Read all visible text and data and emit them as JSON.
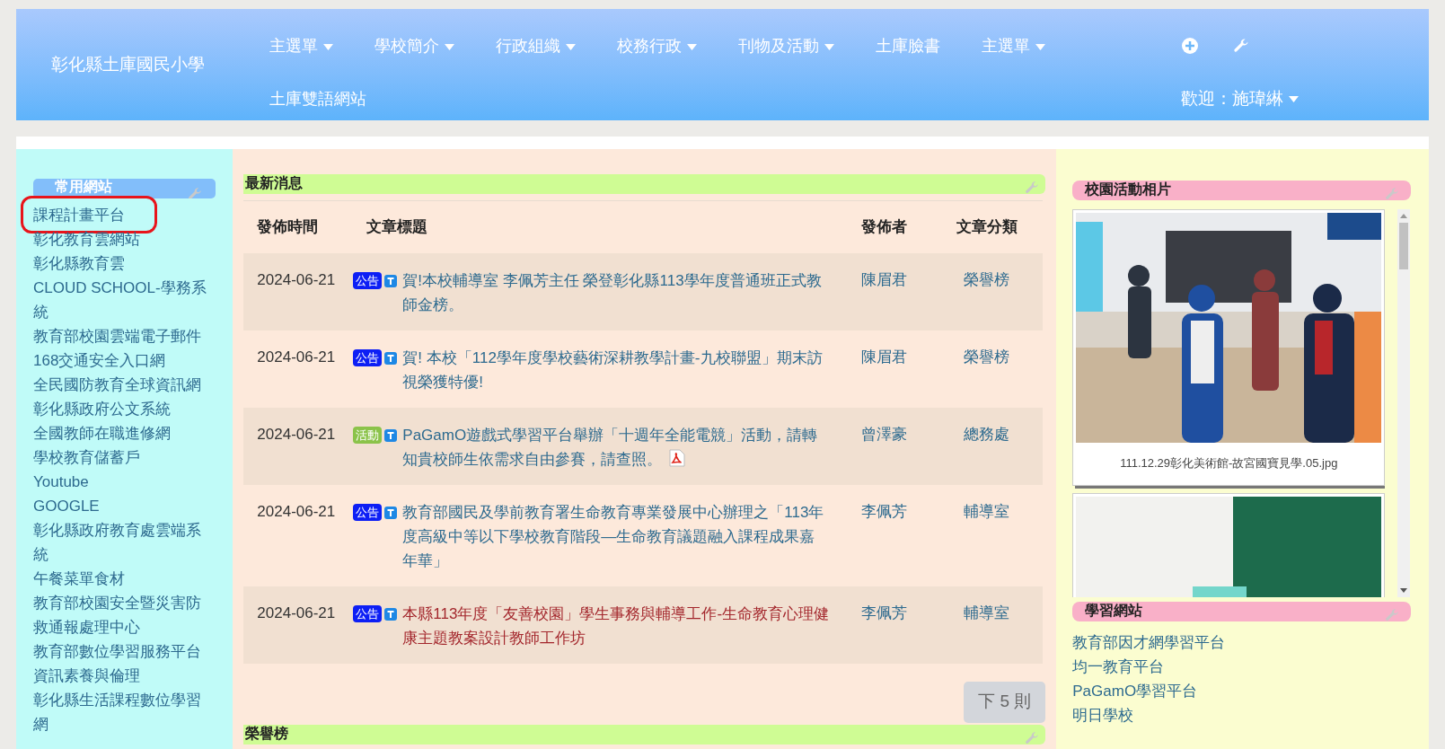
{
  "site_title": "彰化縣土庫國民小學",
  "nav": {
    "items": [
      {
        "label": "主選單",
        "dropdown": true
      },
      {
        "label": "學校簡介",
        "dropdown": true
      },
      {
        "label": "行政組織",
        "dropdown": true
      },
      {
        "label": "校務行政",
        "dropdown": true
      },
      {
        "label": "刊物及活動",
        "dropdown": true
      },
      {
        "label": "土庫臉書",
        "dropdown": false
      },
      {
        "label": "主選單",
        "dropdown": true
      },
      {
        "label": "土庫雙語網站",
        "dropdown": false
      }
    ],
    "welcome": {
      "label": "歡迎：施瑋綝",
      "dropdown": true
    }
  },
  "sidebar": {
    "title": "常用網站",
    "links": [
      {
        "label": "課程計畫平台",
        "circled": true
      },
      {
        "label": "彰化教育雲網站",
        "circled": false
      },
      {
        "label": "彰化縣教育雲",
        "circled": false
      },
      {
        "label": "CLOUD SCHOOL-學務系統",
        "circled": false
      },
      {
        "label": "教育部校園雲端電子郵件",
        "circled": false
      },
      {
        "label": "168交通安全入口網",
        "circled": false
      },
      {
        "label": "全民國防教育全球資訊網",
        "circled": false
      },
      {
        "label": "彰化縣政府公文系統",
        "circled": false
      },
      {
        "label": "全國教師在職進修網",
        "circled": false
      },
      {
        "label": "學校教育儲蓄戶",
        "circled": false
      },
      {
        "label": "Youtube",
        "circled": false
      },
      {
        "label": "GOOGLE",
        "circled": false
      },
      {
        "label": "彰化縣政府教育處雲端系統",
        "circled": false
      },
      {
        "label": "午餐菜單食材",
        "circled": false
      },
      {
        "label": "教育部校園安全暨災害防救通報處理中心",
        "circled": false
      },
      {
        "label": "教育部數位學習服務平台",
        "circled": false
      },
      {
        "label": "資訊素養與倫理",
        "circled": false
      },
      {
        "label": "彰化縣生活課程數位學習網",
        "circled": false
      }
    ]
  },
  "news": {
    "title": "最新消息",
    "columns": [
      "發佈時間",
      "文章標題",
      "發佈者",
      "文章分類"
    ],
    "rows": [
      {
        "date": "2024-06-21",
        "tag": {
          "label": "公告",
          "color": "#0d1ff5"
        },
        "title": "賀!本校輔導室 李佩芳主任 榮登彰化縣113學年度普通班正式教師金榜。",
        "urgent": false,
        "pdf": false,
        "author": "陳眉君",
        "category": "榮譽榜"
      },
      {
        "date": "2024-06-21",
        "tag": {
          "label": "公告",
          "color": "#0d1ff5"
        },
        "title": "賀! 本校「112學年度學校藝術深耕教學計畫-九校聯盟」期末訪視榮獲特優!",
        "urgent": false,
        "pdf": false,
        "author": "陳眉君",
        "category": "榮譽榜"
      },
      {
        "date": "2024-06-21",
        "tag": {
          "label": "活動",
          "color": "#8bc34a"
        },
        "title": "PaGamO遊戲式學習平台舉辦「十週年全能電競」活動，請轉知貴校師生依需求自由參賽，請查照。",
        "urgent": false,
        "pdf": true,
        "author": "曾澤豪",
        "category": "總務處"
      },
      {
        "date": "2024-06-21",
        "tag": {
          "label": "公告",
          "color": "#0d1ff5"
        },
        "title": "教育部國民及學前教育署生命教育專業發展中心辦理之「113年度高級中等以下學校教育階段—生命教育議題融入課程成果嘉年華」",
        "urgent": false,
        "pdf": false,
        "author": "李佩芳",
        "category": "輔導室"
      },
      {
        "date": "2024-06-21",
        "tag": {
          "label": "公告",
          "color": "#0d1ff5"
        },
        "title": "本縣113年度「友善校園」學生事務與輔導工作-生命教育心理健康主題教案設計教師工作坊",
        "urgent": true,
        "pdf": false,
        "author": "李佩芳",
        "category": "輔導室"
      }
    ],
    "more_button": "下 5 則"
  },
  "honor": {
    "title": "榮譽榜"
  },
  "photos": {
    "title": "校園活動相片",
    "items": [
      {
        "kind": "picture",
        "caption": "111.12.29彰化美術館-故宮國寶見學.05.jpg"
      },
      {
        "kind": "picture"
      }
    ]
  },
  "learning": {
    "title": "學習網站",
    "links": [
      "教育部因才網學習平台",
      "均一教育平台",
      "PaGamO學習平台",
      "明日學校"
    ]
  }
}
